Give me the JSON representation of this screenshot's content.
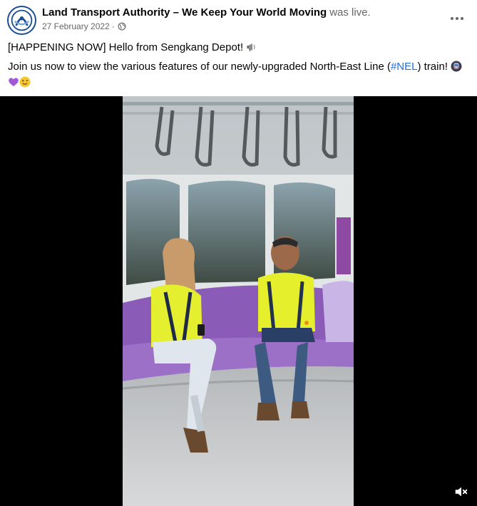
{
  "post": {
    "page_name": "Land Transport Authority – We Keep Your World Moving",
    "status": "was live.",
    "date": "27 February 2022",
    "separator": "·",
    "audience_icon": "globe-icon",
    "menu_icon": "more-options-icon"
  },
  "text": {
    "line1": "[HAPPENING NOW] Hello from Sengkang Depot!",
    "line1_icon": "megaphone-icon",
    "line2_before": "Join us now to view the various features of our newly-upgraded North-East Line (",
    "hashtag": "#NEL",
    "line2_after": ") train!",
    "line2_icons": [
      "train-icon",
      "purple-heart-icon",
      "winking-face-icon"
    ]
  },
  "video": {
    "scene": "train-interior",
    "control_icon": "volume-muted-icon"
  },
  "colors": {
    "text": "#050505",
    "secondary": "#65676b",
    "link": "#216fdb",
    "video_bg": "#000000",
    "seat_purple": "#9b6bc9"
  }
}
